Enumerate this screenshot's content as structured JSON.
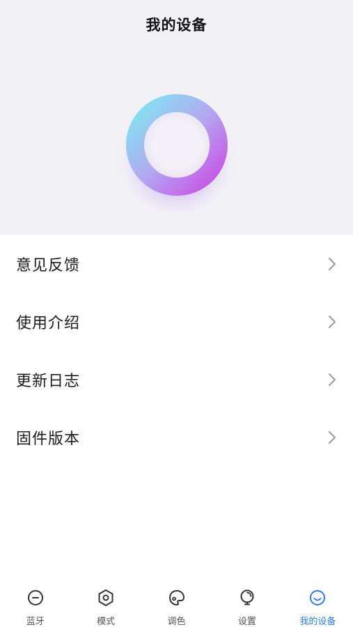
{
  "header": {
    "title": "我的设备"
  },
  "device_ring": {
    "icon": "device-ring-graphic",
    "gradient_colors": [
      "#7fdff0",
      "#b7a6f0",
      "#c653e8"
    ]
  },
  "menu": {
    "items": [
      {
        "label": "意见反馈",
        "icon": "chevron-right-icon"
      },
      {
        "label": "使用介绍",
        "icon": "chevron-right-icon"
      },
      {
        "label": "更新日志",
        "icon": "chevron-right-icon"
      },
      {
        "label": "固件版本",
        "icon": "chevron-right-icon"
      }
    ]
  },
  "tabbar": {
    "active_color": "#2f7ee0",
    "inactive_color": "#333333",
    "tabs": [
      {
        "label": "蓝牙",
        "icon": "bluetooth-icon",
        "active": false
      },
      {
        "label": "模式",
        "icon": "mode-hexagon-icon",
        "active": false
      },
      {
        "label": "调色",
        "icon": "palette-icon",
        "active": false
      },
      {
        "label": "设置",
        "icon": "bulb-settings-icon",
        "active": false
      },
      {
        "label": "我的设备",
        "icon": "smile-face-icon",
        "active": true
      }
    ]
  }
}
